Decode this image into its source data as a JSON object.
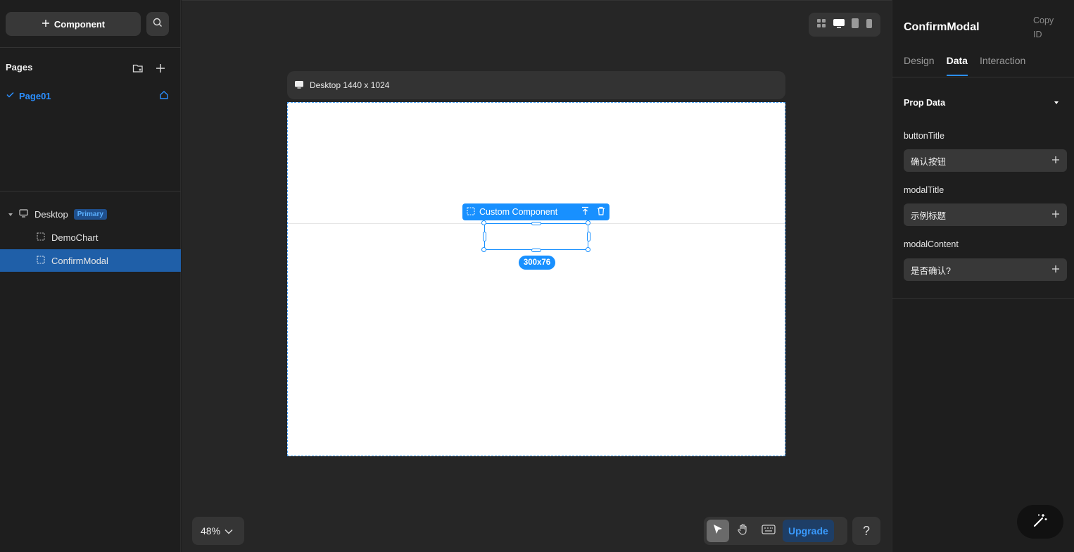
{
  "left_panel": {
    "add_component_label": "Component",
    "pages_title": "Pages",
    "pages": [
      {
        "label": "Page01"
      }
    ],
    "layers": {
      "root": {
        "label": "Desktop",
        "badge": "Primary"
      },
      "children": [
        {
          "label": "DemoChart",
          "selected": false
        },
        {
          "label": "ConfirmModal",
          "selected": true
        }
      ]
    }
  },
  "canvas": {
    "frame_label": "Desktop 1440 x 1024",
    "selection": {
      "label": "Custom Component",
      "size": "300x76"
    },
    "zoom": "48%",
    "upgrade_label": "Upgrade",
    "help_label": "?"
  },
  "right_panel": {
    "title": "ConfirmModal",
    "copy_id_label": "Copy ID",
    "tabs": [
      {
        "label": "Design",
        "active": false
      },
      {
        "label": "Data",
        "active": true
      },
      {
        "label": "Interaction",
        "active": false
      }
    ],
    "section_title": "Prop Data",
    "props": [
      {
        "name": "buttonTitle",
        "value": "确认按钮"
      },
      {
        "name": "modalTitle",
        "value": "示例标题"
      },
      {
        "name": "modalContent",
        "value": "是否确认?"
      }
    ]
  },
  "colors": {
    "accent": "#1890ff",
    "selected_row": "#1f5fa8",
    "panel_bg": "#1e1e1e",
    "canvas_bg": "#262626"
  }
}
